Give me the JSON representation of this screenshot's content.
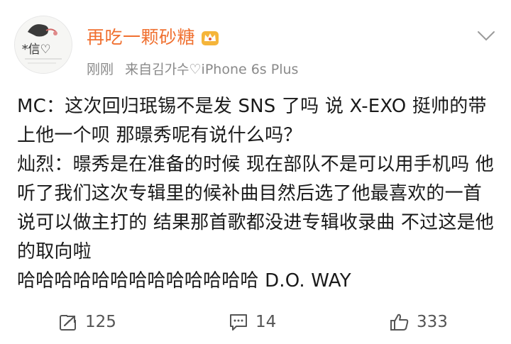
{
  "post": {
    "username": "再吃一颗砂糖",
    "time": "刚刚",
    "source": "来自김가수♡iPhone 6s Plus",
    "avatar_text": "*信♡",
    "lines": [
      "MC：这次回归珉锡不是发 SNS 了吗 说 X-EXO 挺帅的带上他一个呗 那暻秀呢有说什么吗？",
      "灿烈：暻秀是在准备的时候 现在部队不是可以用手机吗 他听了我们这次专辑里的候补曲目然后选了他最喜欢的一首说可以做主打的 结果那首歌都没进专辑收录曲 不过这是他的取向啦",
      "哈哈哈哈哈哈哈哈哈哈哈哈哈 D.O. WAY"
    ]
  },
  "actions": {
    "repost_count": "125",
    "comment_count": "14",
    "like_count": "333"
  },
  "colors": {
    "username": "#f07030",
    "meta": "#8a8a8a",
    "icon": "#555555",
    "vip_badge": "#f0a020"
  },
  "icons": {
    "vip": "crown-badge-icon",
    "menu": "chevron-down-icon",
    "repost": "repost-icon",
    "comment": "comment-icon",
    "like": "thumbs-up-icon"
  }
}
